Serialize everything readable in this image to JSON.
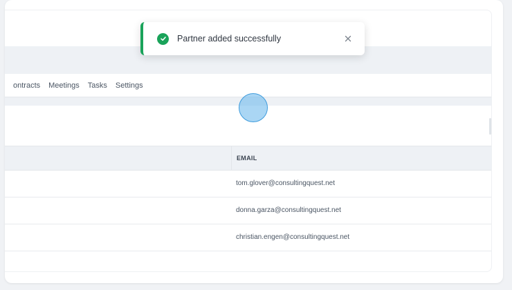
{
  "tabs": [
    "ontracts",
    "Meetings",
    "Tasks",
    "Settings"
  ],
  "table": {
    "email_header": "EMAIL",
    "rows": [
      {
        "email": "tom.glover@consultingquest.net"
      },
      {
        "email": "donna.garza@consultingquest.net"
      },
      {
        "email": "christian.engen@consultingquest.net"
      }
    ]
  },
  "toast": {
    "message": "Partner added successfully",
    "status": "success",
    "accent_color": "#1aa35a",
    "icon": "check-circle-icon",
    "close_icon": "close-icon"
  },
  "colors": {
    "band": "#eef1f5",
    "success": "#1aa35a",
    "cursor": "#3d9bdc"
  }
}
